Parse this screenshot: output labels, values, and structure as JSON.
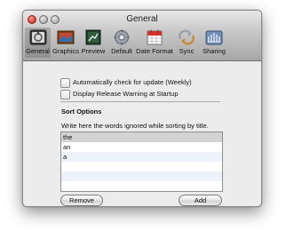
{
  "window": {
    "title": "General"
  },
  "toolbar": {
    "items": [
      {
        "label": "General",
        "icon": "general-icon",
        "selected": true
      },
      {
        "label": "Graphics",
        "icon": "graphics-icon",
        "selected": false
      },
      {
        "label": "Preview",
        "icon": "preview-icon",
        "selected": false
      },
      {
        "label": "Default",
        "icon": "gear-icon",
        "selected": false
      },
      {
        "label": "Date Format",
        "icon": "calendar-icon",
        "selected": false
      },
      {
        "label": "Sync",
        "icon": "sync-icon",
        "selected": false
      },
      {
        "label": "Sharing",
        "icon": "sharing-icon",
        "selected": false
      }
    ]
  },
  "options": {
    "auto_update": {
      "label": "Automatically check for update (Weekly)",
      "checked": false
    },
    "release_warning": {
      "label": "Display Release Warning at Startup",
      "checked": false
    }
  },
  "sort": {
    "title": "Sort Options",
    "description": "Write here the words ignored while sorting by title.",
    "words": [
      "the",
      "an",
      "a"
    ],
    "selected_index": 0
  },
  "buttons": {
    "remove": "Remove",
    "add": "Add"
  }
}
